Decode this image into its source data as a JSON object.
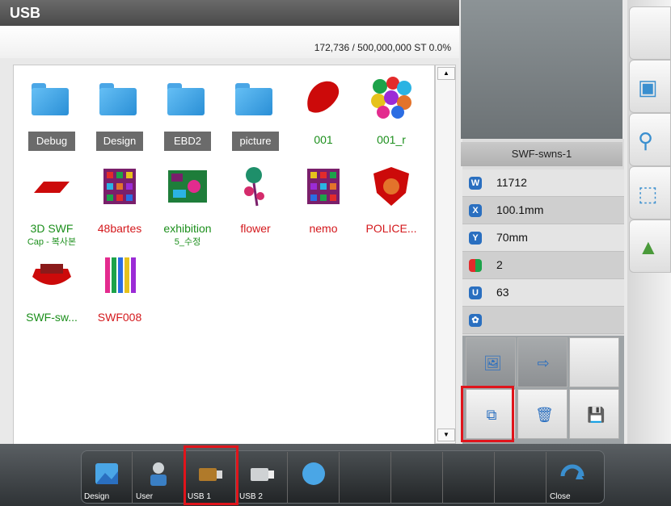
{
  "window": {
    "title": "USB",
    "storage": "172,736 / 500,000,000 ST  0.0%"
  },
  "files": [
    {
      "name": "Debug",
      "kind": "folder"
    },
    {
      "name": "Design",
      "kind": "folder"
    },
    {
      "name": "EBD2",
      "kind": "folder"
    },
    {
      "name": "picture",
      "kind": "folder"
    },
    {
      "name": "001",
      "kind": "design",
      "color": "red"
    },
    {
      "name": "001_r",
      "kind": "design",
      "color": "green"
    },
    {
      "name": "3D SWF",
      "name2": "Cap - 복사본",
      "kind": "design",
      "color": "green"
    },
    {
      "name": "48bartes",
      "kind": "design",
      "color": "red"
    },
    {
      "name": "exhibition",
      "name2": "5_수정",
      "kind": "design",
      "color": "green"
    },
    {
      "name": "flower",
      "kind": "design",
      "color": "red"
    },
    {
      "name": "nemo",
      "kind": "design",
      "color": "red"
    },
    {
      "name": "POLICE...",
      "kind": "design",
      "color": "red"
    },
    {
      "name": "SWF-sw...",
      "kind": "design",
      "color": "green"
    },
    {
      "name": "SWF008",
      "kind": "design",
      "color": "red"
    }
  ],
  "preview": {
    "title": "SWF-swns-1",
    "stitches": "11712",
    "width": "100.1mm",
    "height": "70mm",
    "colors": "2",
    "changes": "63",
    "extra": ""
  },
  "dock": {
    "design_label": "Design",
    "user_label": "User",
    "usb1_label": "USB 1",
    "usb2_label": "USB 2",
    "close_label": "Close"
  },
  "colors": {
    "highlight": "#e0141b",
    "accent": "#2a6fc0"
  }
}
